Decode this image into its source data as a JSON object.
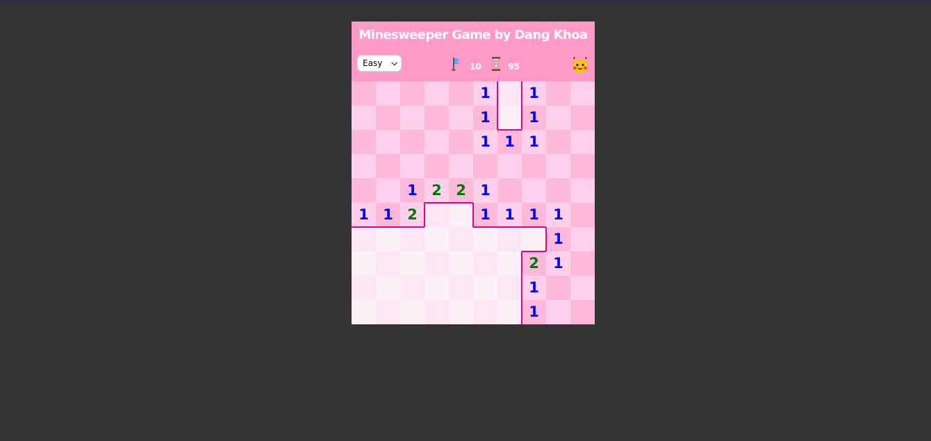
{
  "title": "Minesweeper Game by Dang Khoa",
  "level": {
    "selected": "Easy",
    "options": [
      "Easy"
    ]
  },
  "flags_left": "10",
  "timer": "95",
  "icons": {
    "flag": "flag-icon",
    "hourglass": "hourglass-icon",
    "face": "pikachu-face-icon"
  },
  "colors": {
    "header_bg": "#ff99c8",
    "hidden_dark": "#fcb9da",
    "hidden_light": "#ffcfee",
    "revealed_dark": "#ffe6f4",
    "revealed_light": "#fdf1f8",
    "number_1": "#0000ff",
    "number_2": "#007a00",
    "boundary": "#e6008c"
  },
  "board": {
    "rows": 10,
    "cols": 10,
    "cells": [
      [
        "H",
        "H",
        "H",
        "H",
        "H",
        "1",
        "E",
        "1",
        "H",
        "H"
      ],
      [
        "H",
        "H",
        "H",
        "H",
        "H",
        "1",
        "E",
        "1",
        "H",
        "H"
      ],
      [
        "H",
        "H",
        "H",
        "H",
        "H",
        "1",
        "1",
        "1",
        "H",
        "H"
      ],
      [
        "H",
        "H",
        "H",
        "H",
        "H",
        "H",
        "H",
        "H",
        "H",
        "H"
      ],
      [
        "H",
        "H",
        "1",
        "2",
        "2",
        "1",
        "H",
        "H",
        "H",
        "H"
      ],
      [
        "1",
        "1",
        "2",
        "E",
        "E",
        "1",
        "1",
        "1",
        "1",
        "H"
      ],
      [
        "E",
        "E",
        "E",
        "E",
        "E",
        "E",
        "E",
        "E",
        "1",
        "H"
      ],
      [
        "E",
        "E",
        "E",
        "E",
        "E",
        "E",
        "E",
        "2",
        "1",
        "H"
      ],
      [
        "E",
        "E",
        "E",
        "E",
        "E",
        "E",
        "E",
        "1",
        "H",
        "H"
      ],
      [
        "E",
        "E",
        "E",
        "E",
        "E",
        "E",
        "E",
        "1",
        "H",
        "H"
      ]
    ]
  }
}
